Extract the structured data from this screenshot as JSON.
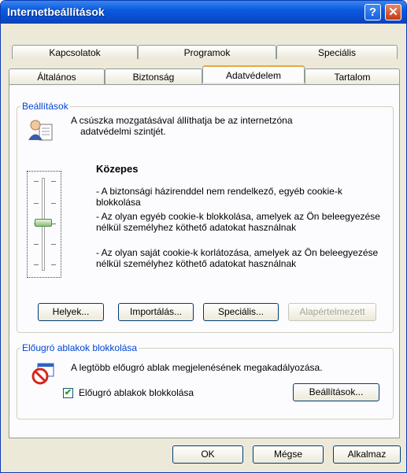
{
  "window": {
    "title": "Internetbeállítások"
  },
  "titlebar": {
    "help_glyph": "?",
    "close_glyph": "✕"
  },
  "tabs_back": [
    "Kapcsolatok",
    "Programok",
    "Speciális"
  ],
  "tabs_front": [
    "Általános",
    "Biztonság",
    "Adatvédelem",
    "Tartalom"
  ],
  "settings": {
    "legend": "Beállítások",
    "intro_line1": "A csúszka mozgatásával állíthatja be az internetzóna",
    "intro_line2": "adatvédelmi szintjét.",
    "level_title": "Közepes",
    "bullets": [
      "- A biztonsági házirenddel nem rendelkező, egyéb cookie-k blokkolása",
      "- Az olyan egyéb cookie-k blokkolása, amelyek az Ön beleegyezése nélkül személyhez köthető adatokat használnak",
      "- Az olyan saját cookie-k korlátozása, amelyek az Ön beleegyezése nélkül személyhez köthető adatokat használnak"
    ],
    "buttons": {
      "sites": "Helyek...",
      "import": "Importálás...",
      "advanced": "Speciális...",
      "default": "Alapértelmezett"
    }
  },
  "popup": {
    "legend": "Előugró ablakok blokkolása",
    "description": "A legtöbb előugró ablak megjelenésének megakadályozása.",
    "checkbox_label": "Előugró ablakok blokkolása",
    "checkbox_checked": true,
    "settings_button": "Beállítások..."
  },
  "footer": {
    "ok": "OK",
    "cancel": "Mégse",
    "apply": "Alkalmaz"
  },
  "icons": {
    "privacy_icon": "person-with-document-icon",
    "popup_icon": "block-popup-icon"
  }
}
